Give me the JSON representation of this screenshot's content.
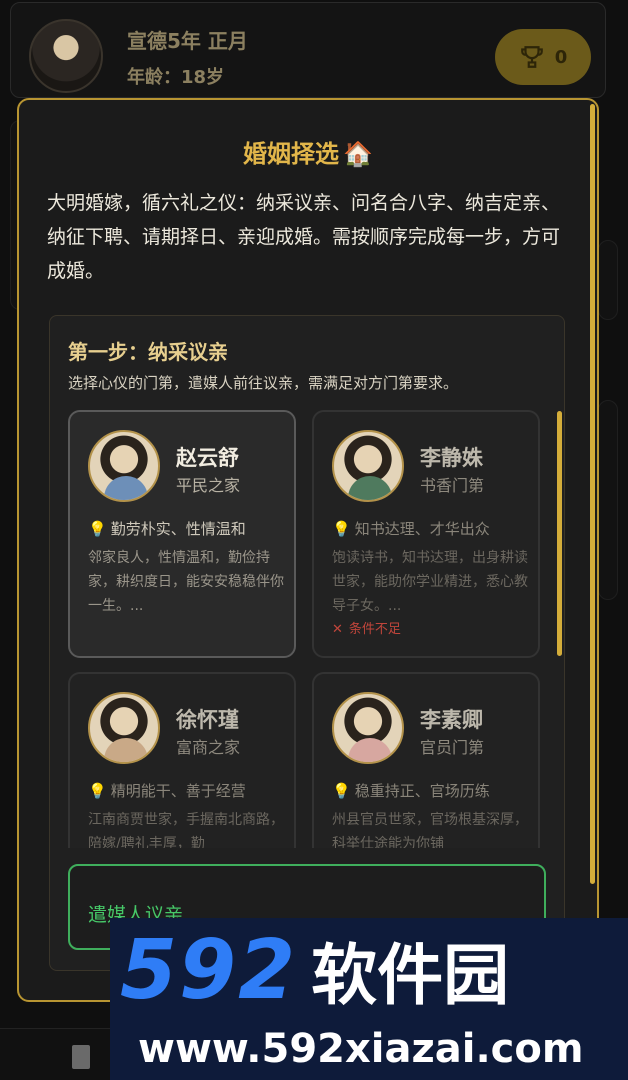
{
  "topbar": {
    "era": "宣德5年 正月",
    "age": "年龄：18岁",
    "trophy_count": "0"
  },
  "modal": {
    "title": "婚姻择选",
    "title_icon": "house-icon",
    "intro": "大明婚嫁，循六礼之仪：纳采议亲、问名合八字、纳吉定亲、纳征下聘、请期择日、亲迎成婚。需按顺序完成每一步，方可成婚。",
    "step": {
      "title": "第一步：纳采议亲",
      "desc": "选择心仪的门第，遣媒人前往议亲，需满足对方门第要求。",
      "candidates": [
        {
          "name": "赵云舒",
          "family": "平民之家",
          "trait": "勤劳朴实、性情温和",
          "bio": "邻家良人，性情温和，勤俭持家，耕织度日，能安安稳稳伴你一生。...",
          "robe_color": "#6d8fb8"
        },
        {
          "name": "李静姝",
          "family": "书香门第",
          "trait": "知书达理、才华出众",
          "bio": "饱读诗书，知书达理，出身耕读世家，能助你学业精进，悉心教导子女。...",
          "fail": "条件不足",
          "robe_color": "#4f7a5e"
        },
        {
          "name": "徐怀瑾",
          "family": "富商之家",
          "trait": "精明能干、善于经营",
          "bio": "江南商贾世家，手握南北商路，陪嫁/聘礼丰厚，勤",
          "robe_color": "#c9a987"
        },
        {
          "name": "李素卿",
          "family": "官员门第",
          "trait": "稳重持正、官场历练",
          "bio": "州县官员世家，官场根基深厚，科举仕途能为你铺",
          "robe_color": "#d7a7a0"
        }
      ],
      "action_label": "遣媒人议亲"
    }
  },
  "watermark": {
    "number": "592",
    "brand": "软件园",
    "url": "www.592xiazai.com"
  }
}
